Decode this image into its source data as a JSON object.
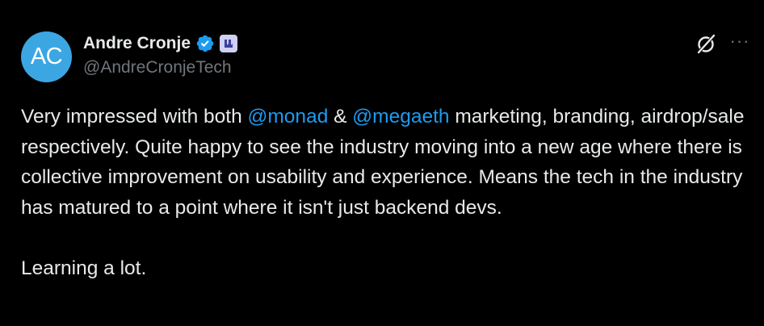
{
  "author": {
    "avatar_initials": "AC",
    "avatar_color": "#3ca6e3",
    "display_name": "Andre Cronje",
    "handle": "@AndreCronjeTech",
    "verified_icon": "verified-badge-icon",
    "affiliate_icon": "affiliate-badge-icon"
  },
  "actions": {
    "grok_icon": "grok-icon",
    "more_icon": "more-options-icon",
    "more_glyph": "···"
  },
  "tweet": {
    "text_part1": "Very impressed with both ",
    "mention1": "@monad",
    "text_part2": " & ",
    "mention2": "@megaeth",
    "text_part3": " marketing, branding, airdrop/sale respectively. Quite happy to see the industry moving into a new age where there is collective improvement on usability and experience. Means the tech in the industry has matured to a point where it isn't just backend devs.",
    "paragraph2": "Learning a lot."
  },
  "colors": {
    "background": "#000000",
    "text": "#e7e9ea",
    "secondary": "#71767b",
    "accent": "#1d9bf0"
  }
}
